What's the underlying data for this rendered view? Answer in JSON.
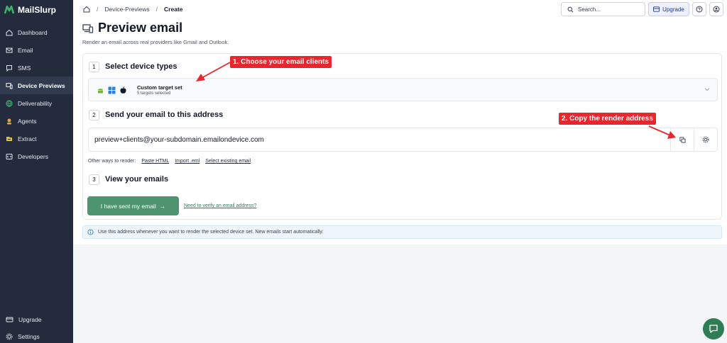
{
  "brand": {
    "name": "MailSlurp",
    "accent": "#3fb36a"
  },
  "sidebar": {
    "items": [
      {
        "label": "Dashboard",
        "icon": "home-icon"
      },
      {
        "label": "Email",
        "icon": "mail-icon"
      },
      {
        "label": "SMS",
        "icon": "message-icon"
      },
      {
        "label": "Device Previews",
        "icon": "device-icon",
        "active": true
      },
      {
        "label": "Deliverability",
        "icon": "globe-icon"
      },
      {
        "label": "Agents",
        "icon": "agent-icon"
      },
      {
        "label": "Extract",
        "icon": "extract-icon"
      },
      {
        "label": "Developers",
        "icon": "code-icon"
      }
    ],
    "bottom": [
      {
        "label": "Upgrade",
        "icon": "upgrade-icon"
      },
      {
        "label": "Settings",
        "icon": "gear-icon"
      }
    ]
  },
  "breadcrumb": {
    "items": [
      "Device-Previews",
      "Create"
    ]
  },
  "topbar": {
    "search_placeholder": "Search...",
    "upgrade_label": "Upgrade"
  },
  "page": {
    "title": "Preview email",
    "subtitle": "Render an email across real providers like Gmail and Outlook."
  },
  "steps": {
    "step1": {
      "num": "1",
      "title": "Select device types",
      "target_title": "Custom target set",
      "target_sub": "5 targets selected"
    },
    "step2": {
      "num": "2",
      "title": "Send your email to this address",
      "address": "preview+clients@your-subdomain.emailondevice.com"
    },
    "other": {
      "label": "Other ways to render:",
      "paste": "Paste HTML",
      "import": "Import .eml",
      "select": "Select existing email"
    },
    "step3": {
      "num": "3",
      "title": "View your emails",
      "sent_button": "I have sent my email",
      "verify_link": "Need to verify an email address?"
    }
  },
  "info": {
    "text": "Use this address whenever you want to render the selected device set. New emails start automatically."
  },
  "callouts": {
    "one": "1. Choose your email clients",
    "two": "2. Copy the render address",
    "color": "#e8262d"
  }
}
